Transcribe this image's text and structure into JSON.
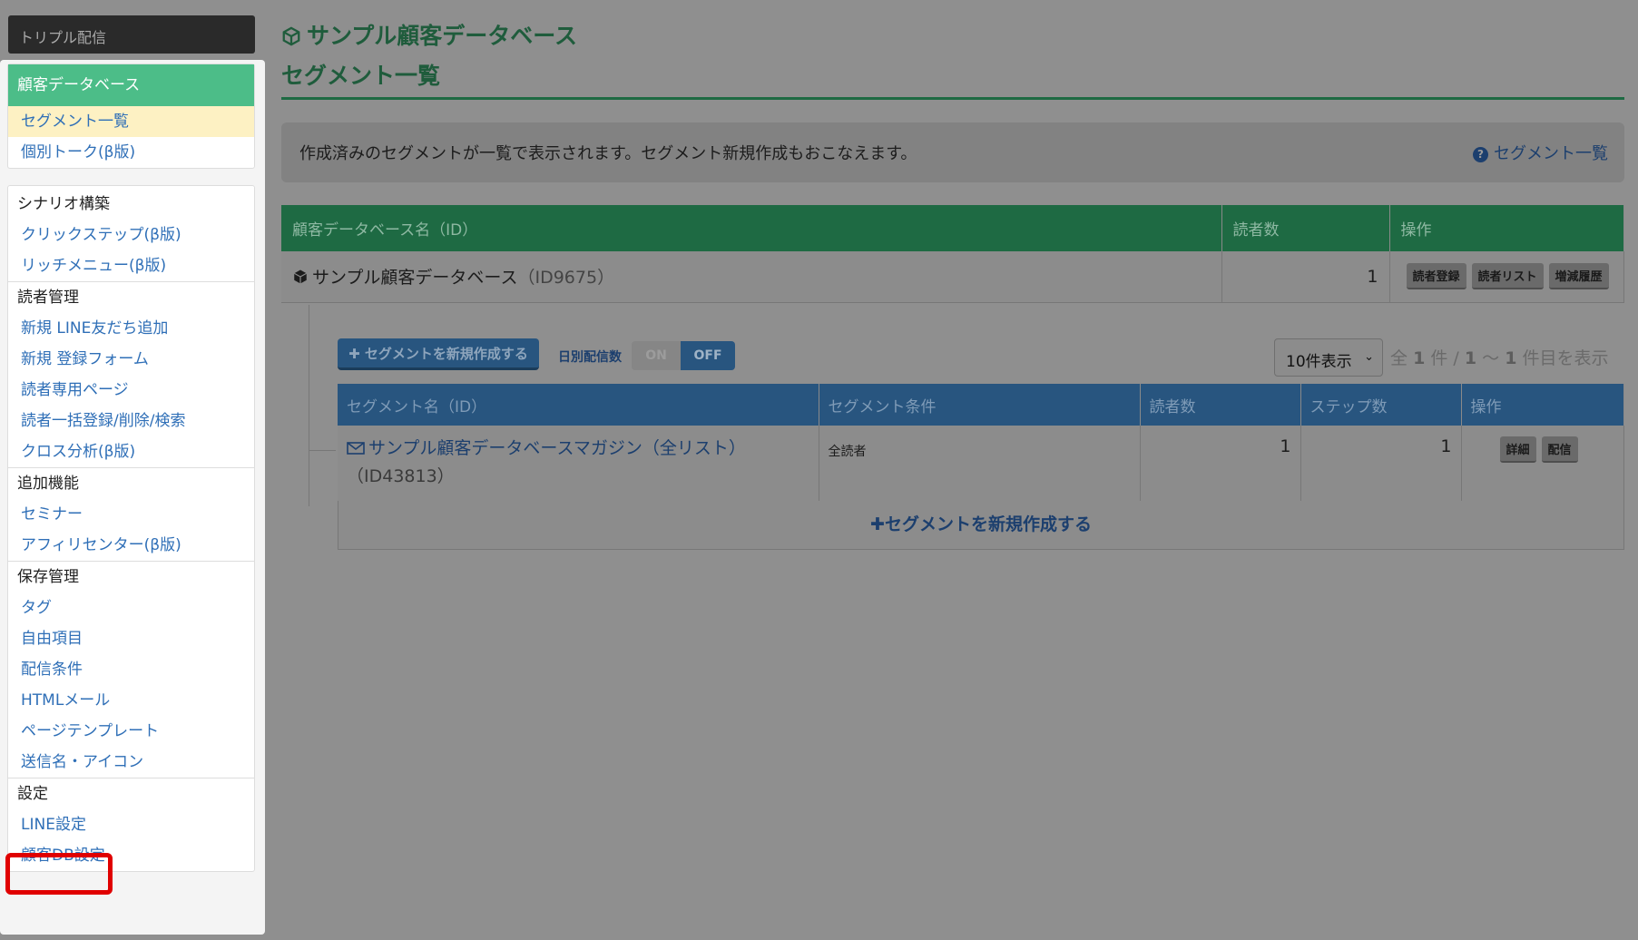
{
  "app_title": "トリプル配信",
  "sidebar": {
    "db_header": "顧客データベース",
    "db_items": [
      "セグメント一覧",
      "個別トーク(β版)"
    ],
    "sections": [
      {
        "caption": "シナリオ構築",
        "items": [
          "クリックステップ(β版)",
          "リッチメニュー(β版)"
        ]
      },
      {
        "caption": "読者管理",
        "items": [
          "新規 LINE友だち追加",
          "新規 登録フォーム",
          "読者専用ページ",
          "読者一括登録/削除/検索",
          "クロス分析(β版)"
        ]
      },
      {
        "caption": "追加機能",
        "items": [
          "セミナー",
          "アフィリセンター(β版)"
        ]
      },
      {
        "caption": "保存管理",
        "items": [
          "タグ",
          "自由項目",
          "配信条件",
          "HTMLメール",
          "ページテンプレート",
          "送信名・アイコン"
        ]
      },
      {
        "caption": "設定",
        "items": [
          "LINE設定",
          "顧客DB設定"
        ]
      }
    ]
  },
  "main": {
    "db_title": "サンプル顧客データベース",
    "page_title": "セグメント一覧",
    "info_text": "作成済みのセグメントが一覧で表示されます。セグメント新規作成もおこなえます。",
    "help_link": "セグメント一覧",
    "db_table": {
      "headers": [
        "顧客データベース名（ID）",
        "読者数",
        "操作"
      ],
      "row": {
        "name": "サンプル顧客データベース",
        "id": "（ID9675）",
        "count": "1",
        "buttons": [
          "読者登録",
          "読者リスト",
          "増減履歴"
        ]
      }
    },
    "new_segment_button": "セグメントを新規作成する",
    "daily_label": "日別配信数",
    "toggle_on": "ON",
    "toggle_off": "OFF",
    "per_page": "10件表示",
    "paging": {
      "prefix": "全",
      "total": "1",
      "mid": "件 /",
      "from": "1",
      "tilde": "〜",
      "to": "1",
      "suffix": "件目を表示"
    },
    "seg_table": {
      "headers": [
        "セグメント名（ID）",
        "セグメント条件",
        "読者数",
        "ステップ数",
        "操作"
      ],
      "row": {
        "name": "サンプル顧客データベースマガジン（全リスト）",
        "id": "（ID43813）",
        "condition": "全読者",
        "readers": "1",
        "steps": "1",
        "buttons": [
          "詳細",
          "配信"
        ]
      }
    },
    "bottom_new": "セグメントを新規作成する"
  },
  "colors": {
    "green_header": "#1e6a43",
    "blue_header": "#28557f",
    "active_item": "#fdf1c3",
    "highlight": "#e00000"
  }
}
